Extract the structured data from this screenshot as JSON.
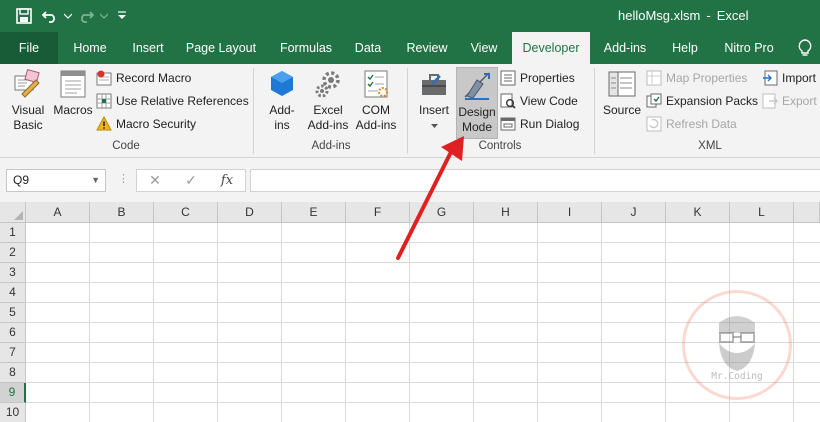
{
  "window": {
    "filename": "helloMsg.xlsm",
    "separator": "-",
    "app_name": "Excel"
  },
  "tabs": [
    {
      "label": "File"
    },
    {
      "label": "Home"
    },
    {
      "label": "Insert"
    },
    {
      "label": "Page Layout"
    },
    {
      "label": "Formulas"
    },
    {
      "label": "Data"
    },
    {
      "label": "Review"
    },
    {
      "label": "View"
    },
    {
      "label": "Developer"
    },
    {
      "label": "Add-ins"
    },
    {
      "label": "Help"
    },
    {
      "label": "Nitro Pro"
    }
  ],
  "active_tab": "Developer",
  "ribbon": {
    "code": {
      "label": "Code",
      "visual_basic": [
        "Visual",
        "Basic"
      ],
      "macros": "Macros",
      "record_macro": "Record Macro",
      "relative_refs": "Use Relative References",
      "macro_security": "Macro Security"
    },
    "addins": {
      "label": "Add-ins",
      "addins_btn": [
        "Add-",
        "ins"
      ],
      "excel_addins": [
        "Excel",
        "Add-ins"
      ],
      "com_addins": [
        "COM",
        "Add-ins"
      ]
    },
    "controls": {
      "label": "Controls",
      "insert": "Insert",
      "design_mode": [
        "Design",
        "Mode"
      ],
      "properties": "Properties",
      "view_code": "View Code",
      "run_dialog": "Run Dialog"
    },
    "xml": {
      "label": "XML",
      "source": "Source",
      "map_properties": "Map Properties",
      "expansion_packs": "Expansion Packs",
      "refresh_data": "Refresh Data",
      "import": "Import",
      "export": "Export"
    }
  },
  "formula_bar": {
    "name_box": "Q9",
    "dots": "⋮",
    "cancel": "✕",
    "enter": "✓",
    "fx": "fx",
    "value": ""
  },
  "columns": [
    "A",
    "B",
    "C",
    "D",
    "E",
    "F",
    "G",
    "H",
    "I",
    "J",
    "K",
    "L"
  ],
  "rows": [
    "1",
    "2",
    "3",
    "4",
    "5",
    "6",
    "7",
    "8",
    "9",
    "10"
  ],
  "selected_row": "9",
  "watermark": "Mr.Coding",
  "colors": {
    "excel_green": "#217346",
    "file_tab": "#185c37",
    "ribbon_bg": "#f3f3f3",
    "annotation_arrow": "#e02020"
  }
}
